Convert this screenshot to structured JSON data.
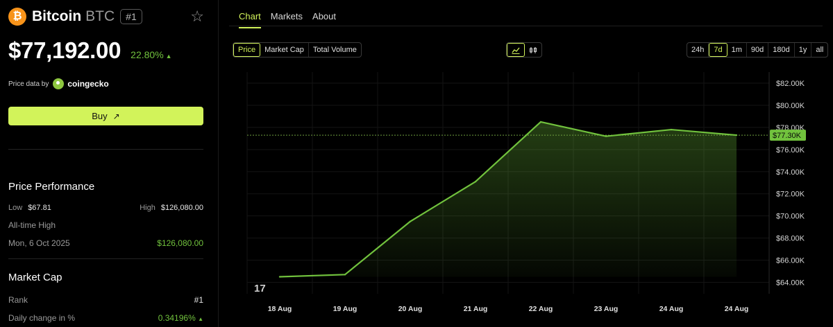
{
  "coin": {
    "logo_glyph": "₿",
    "name": "Bitcoin",
    "symbol": "BTC",
    "rank_badge": "#1",
    "price": "$77,192.00",
    "change_pct": "22.80%",
    "change_arrow": "▲",
    "price_source_label": "Price data by",
    "price_source_name": "coingecko"
  },
  "buy": {
    "label": "Buy",
    "icon": "↗"
  },
  "performance": {
    "title": "Price Performance",
    "low_label": "Low",
    "low_value": "$67.81",
    "high_label": "High",
    "high_value": "$126,080.00",
    "ath_label": "All-time High",
    "ath_date": "Mon, 6 Oct 2025",
    "ath_value": "$126,080.00"
  },
  "market_cap": {
    "title": "Market Cap",
    "rank_label": "Rank",
    "rank_value": "#1",
    "daily_change_label": "Daily change in %",
    "daily_change_value": "0.34196%",
    "daily_change_arrow": "▲"
  },
  "tabs": [
    "Chart",
    "Markets",
    "About"
  ],
  "metric_options": [
    "Price",
    "Market Cap",
    "Total Volume"
  ],
  "range_options": [
    "24h",
    "7d",
    "1m",
    "90d",
    "180d",
    "1y",
    "all"
  ],
  "selected_range": "7d",
  "tv_logo": "17",
  "colors": {
    "accent": "#d2f35a",
    "line": "#71c23d",
    "positive": "#71c23d",
    "bitcoin": "#f7931a"
  },
  "chart_data": {
    "type": "area",
    "x": [
      "18 Aug",
      "19 Aug",
      "20 Aug",
      "21 Aug",
      "22 Aug",
      "23 Aug",
      "24 Aug",
      "24 Aug"
    ],
    "y_tick_labels": [
      "$82.00K",
      "$80.00K",
      "$78.00K",
      "$76.00K",
      "$74.00K",
      "$72.00K",
      "$70.00K",
      "$68.00K",
      "$66.00K",
      "$64.00K"
    ],
    "y_ticks": [
      82000,
      80000,
      78000,
      76000,
      74000,
      72000,
      70000,
      68000,
      66000,
      64000
    ],
    "ylim": [
      64000,
      82000
    ],
    "series": [
      {
        "values": [
          64500,
          64700,
          69500,
          73100,
          78500,
          77200,
          77800,
          77300
        ]
      }
    ],
    "current_value": 77300,
    "current_label": "$77.30K",
    "grid": true
  }
}
